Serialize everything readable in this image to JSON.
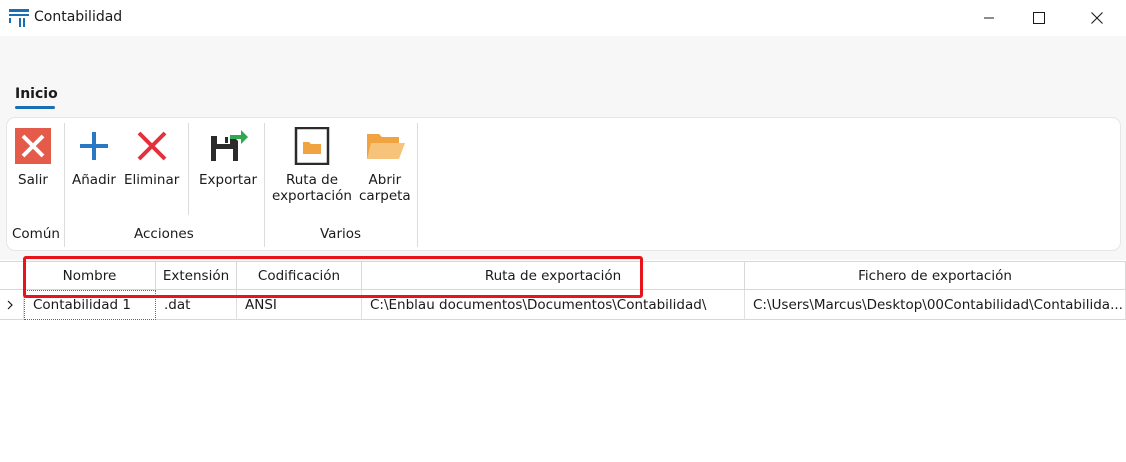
{
  "window": {
    "title": "Contabilidad"
  },
  "tabs": [
    {
      "label": "Inicio"
    }
  ],
  "ribbon": {
    "groups": [
      {
        "label": "Común",
        "buttons": [
          {
            "label": "Salir",
            "icon": "exit-icon"
          }
        ]
      },
      {
        "label": "Acciones",
        "buttons": [
          {
            "label": "Añadir",
            "icon": "plus-icon"
          },
          {
            "label": "Eliminar",
            "icon": "x-icon"
          },
          {
            "label": "Exportar",
            "icon": "save-export-icon"
          }
        ]
      },
      {
        "label": "Varios",
        "buttons": [
          {
            "label": "Ruta de exportación",
            "line1": "Ruta de",
            "line2": "exportación",
            "icon": "folder-box-icon"
          },
          {
            "label": "Abrir carpeta",
            "line1": "Abrir",
            "line2": "carpeta",
            "icon": "open-folder-icon"
          }
        ]
      }
    ]
  },
  "table": {
    "columns": [
      "Nombre",
      "Extensión",
      "Codificación",
      "Ruta de exportación",
      "Fichero de exportación"
    ],
    "rows": [
      [
        "Contabilidad 1",
        ".dat",
        "ANSI",
        "C:\\Enblau documentos\\Documentos\\Contabilidad\\",
        "C:\\Users\\Marcus\\Desktop\\00Contabilidad\\Contabilida..."
      ]
    ]
  },
  "colors": {
    "accent": "#1a6fb4",
    "highlight": "#e8141c",
    "exit": "#e55b4a",
    "plus": "#2a78c4",
    "delete": "#e3303a",
    "folder": "#f0a340"
  }
}
